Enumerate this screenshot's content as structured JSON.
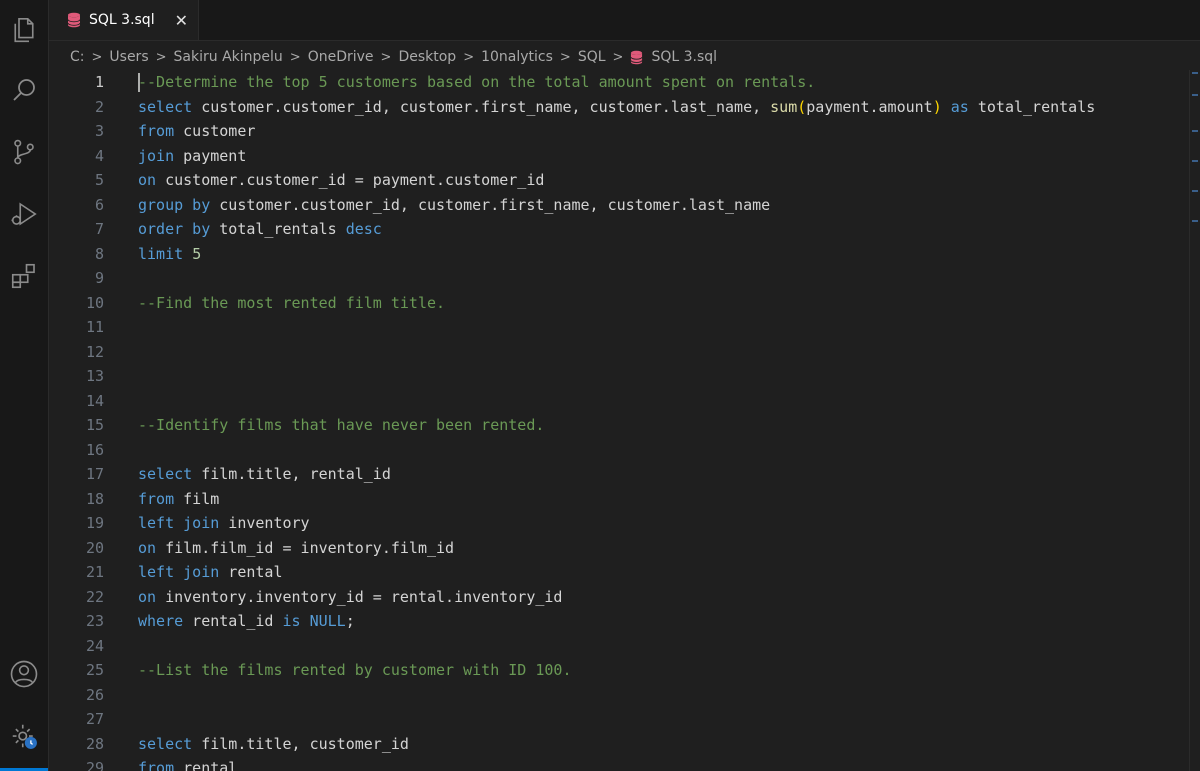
{
  "tab": {
    "label": "SQL 3.sql",
    "close_symbol": "✕"
  },
  "breadcrumb": [
    "C:",
    "Users",
    "Sakiru Akinpelu",
    "OneDrive",
    "Desktop",
    "10nalytics",
    "SQL"
  ],
  "breadcrumb_file": "SQL 3.sql",
  "breadcrumb_separator": ">",
  "activity_bar": [
    "explorer-icon",
    "search-icon",
    "source-control-icon",
    "run-debug-icon",
    "extensions-icon",
    "account-icon",
    "settings-icon"
  ],
  "colors": {
    "keyword": "#569cd6",
    "comment": "#6a9955",
    "function": "#dcdcaa",
    "number": "#b5cea8",
    "bracket": "#ffd700",
    "sql_file_icon": "#e05a7a"
  },
  "active_line": 1,
  "lines": [
    {
      "n": "1",
      "parts": [
        {
          "t": "cm",
          "v": "--Determine the top 5 customers based on the total amount spent on rentals."
        }
      ]
    },
    {
      "n": "2",
      "parts": [
        {
          "t": "kw",
          "v": "select"
        },
        {
          "t": "id",
          "v": " customer.customer_id, customer.first_name, customer.last_name, "
        },
        {
          "t": "fn",
          "v": "sum"
        },
        {
          "t": "br",
          "v": "("
        },
        {
          "t": "id",
          "v": "payment.amount"
        },
        {
          "t": "br",
          "v": ")"
        },
        {
          "t": "id",
          "v": " "
        },
        {
          "t": "kw",
          "v": "as"
        },
        {
          "t": "id",
          "v": " total_rentals"
        }
      ]
    },
    {
      "n": "3",
      "parts": [
        {
          "t": "kw",
          "v": "from"
        },
        {
          "t": "id",
          "v": " customer"
        }
      ]
    },
    {
      "n": "4",
      "parts": [
        {
          "t": "kw",
          "v": "join"
        },
        {
          "t": "id",
          "v": " payment"
        }
      ]
    },
    {
      "n": "5",
      "parts": [
        {
          "t": "kw",
          "v": "on"
        },
        {
          "t": "id",
          "v": " customer.customer_id = payment.customer_id"
        }
      ]
    },
    {
      "n": "6",
      "parts": [
        {
          "t": "kw",
          "v": "group by"
        },
        {
          "t": "id",
          "v": " customer.customer_id, customer.first_name, customer.last_name"
        }
      ]
    },
    {
      "n": "7",
      "parts": [
        {
          "t": "kw",
          "v": "order by"
        },
        {
          "t": "id",
          "v": " total_rentals "
        },
        {
          "t": "kw",
          "v": "desc"
        }
      ]
    },
    {
      "n": "8",
      "parts": [
        {
          "t": "kw",
          "v": "limit"
        },
        {
          "t": "id",
          "v": " "
        },
        {
          "t": "num",
          "v": "5"
        }
      ]
    },
    {
      "n": "9",
      "parts": []
    },
    {
      "n": "10",
      "parts": [
        {
          "t": "cm",
          "v": "--Find the most rented film title."
        }
      ]
    },
    {
      "n": "11",
      "parts": []
    },
    {
      "n": "12",
      "parts": []
    },
    {
      "n": "13",
      "parts": []
    },
    {
      "n": "14",
      "parts": []
    },
    {
      "n": "15",
      "parts": [
        {
          "t": "cm",
          "v": "--Identify films that have never been rented."
        }
      ]
    },
    {
      "n": "16",
      "parts": []
    },
    {
      "n": "17",
      "parts": [
        {
          "t": "kw",
          "v": "select"
        },
        {
          "t": "id",
          "v": " film.title, rental_id"
        }
      ]
    },
    {
      "n": "18",
      "parts": [
        {
          "t": "kw",
          "v": "from"
        },
        {
          "t": "id",
          "v": " film"
        }
      ]
    },
    {
      "n": "19",
      "parts": [
        {
          "t": "kw",
          "v": "left join"
        },
        {
          "t": "id",
          "v": " inventory"
        }
      ]
    },
    {
      "n": "20",
      "parts": [
        {
          "t": "kw",
          "v": "on"
        },
        {
          "t": "id",
          "v": " film.film_id = inventory.film_id"
        }
      ]
    },
    {
      "n": "21",
      "parts": [
        {
          "t": "kw",
          "v": "left join"
        },
        {
          "t": "id",
          "v": " rental"
        }
      ]
    },
    {
      "n": "22",
      "parts": [
        {
          "t": "kw",
          "v": "on"
        },
        {
          "t": "id",
          "v": " inventory.inventory_id = rental.inventory_id"
        }
      ]
    },
    {
      "n": "23",
      "parts": [
        {
          "t": "kw",
          "v": "where"
        },
        {
          "t": "id",
          "v": " rental_id "
        },
        {
          "t": "kw",
          "v": "is"
        },
        {
          "t": "id",
          "v": " "
        },
        {
          "t": "kw",
          "v": "NULL"
        },
        {
          "t": "id",
          "v": ";"
        }
      ]
    },
    {
      "n": "24",
      "parts": []
    },
    {
      "n": "25",
      "parts": [
        {
          "t": "cm",
          "v": "--List the films rented by customer with ID 100."
        }
      ]
    },
    {
      "n": "26",
      "parts": []
    },
    {
      "n": "27",
      "parts": []
    },
    {
      "n": "28",
      "parts": [
        {
          "t": "kw",
          "v": "select"
        },
        {
          "t": "id",
          "v": " film.title, customer_id"
        }
      ]
    },
    {
      "n": "29",
      "parts": [
        {
          "t": "kw",
          "v": "from"
        },
        {
          "t": "id",
          "v": " rental"
        }
      ]
    }
  ]
}
